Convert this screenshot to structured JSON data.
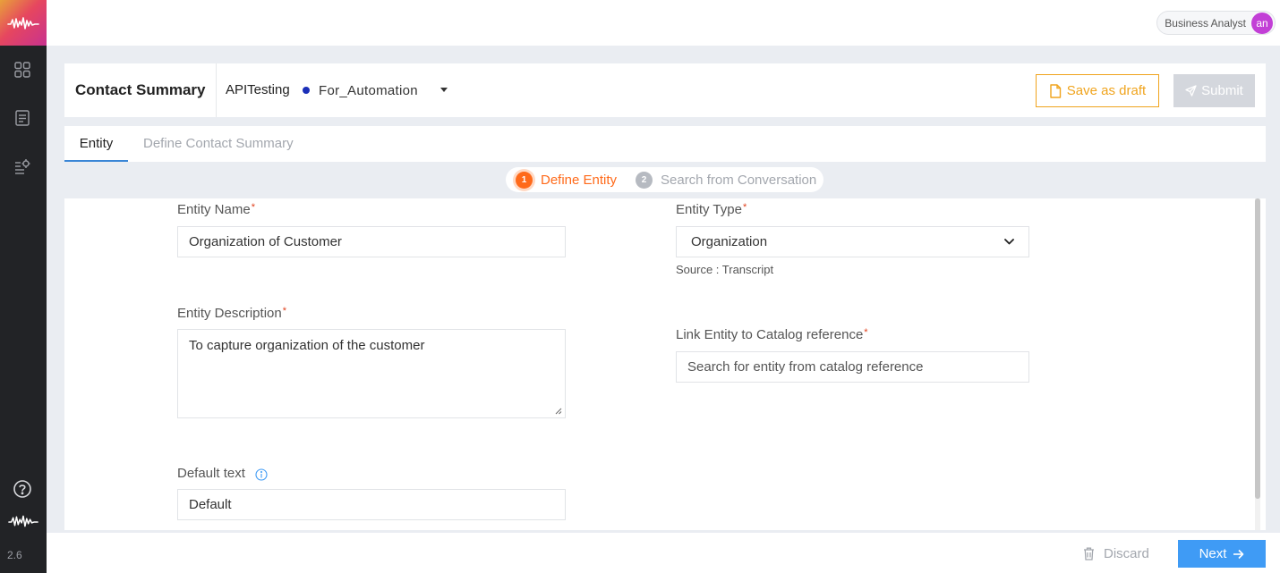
{
  "app": {
    "version": "2.6"
  },
  "sidebar": {
    "icons": [
      "waveform-logo-icon",
      "grid-icon",
      "document-list-icon",
      "settings-list-icon",
      "help-icon",
      "waveform-icon"
    ]
  },
  "topbar": {
    "user_role": "Business Analyst",
    "avatar_initials": "an"
  },
  "header": {
    "title": "Contact Summary",
    "project": "APITesting",
    "environment": "For_Automation",
    "save_draft_label": "Save as draft",
    "submit_label": "Submit"
  },
  "tabs": [
    {
      "label": "Entity",
      "active": true
    },
    {
      "label": "Define Contact Summary",
      "active": false
    }
  ],
  "stepper": {
    "steps": [
      {
        "number": "1",
        "label": "Define Entity",
        "active": true
      },
      {
        "number": "2",
        "label": "Search from Conversation",
        "active": false
      }
    ]
  },
  "form": {
    "entity_name": {
      "label": "Entity Name",
      "required": "*",
      "value": "Organization of Customer"
    },
    "entity_type": {
      "label": "Entity Type",
      "required": "*",
      "value": "Organization",
      "hint": "Source : Transcript"
    },
    "entity_description": {
      "label": "Entity Description",
      "required": "*",
      "value": "To capture organization of the customer"
    },
    "catalog_reference": {
      "label": "Link Entity to Catalog reference",
      "required": "*",
      "placeholder": "Search for entity from catalog reference"
    },
    "default_text": {
      "label": "Default text",
      "value": "Default"
    }
  },
  "footer": {
    "discard_label": "Discard",
    "next_label": "Next"
  },
  "colors": {
    "accent_orange": "#ff6a1a",
    "draft_orange": "#f0a41d",
    "primary_blue": "#3f9bf5",
    "sidebar_bg": "#222326",
    "avatar_purple": "#c23fd6"
  }
}
